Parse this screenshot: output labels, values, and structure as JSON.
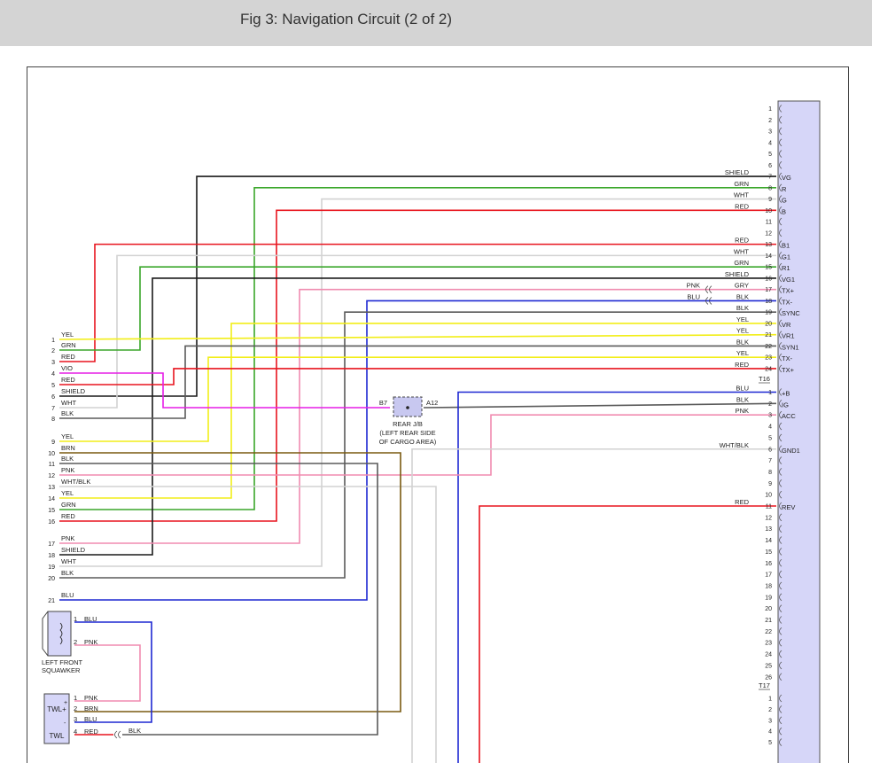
{
  "header": {
    "title": "Fig 3: Navigation Circuit (2 of 2)"
  },
  "colors": {
    "RED": "#e8141e",
    "GRN": "#3aa62a",
    "YEL": "#f2ee18",
    "BLK": "#1a1a1a",
    "WHT": "#d2d2d2",
    "SHIELD": "#1a1a1a",
    "PNK": "#f08cb0",
    "BLU": "#1e28d2",
    "VIO": "#e61ee6",
    "BRN": "#7a5a10",
    "GRY": "#5a5a5a",
    "WHT/BLK": "#d2d2d2"
  },
  "connector_t16_label": "T16",
  "connector_t17_label": "T17",
  "right_connector_pins": [
    {
      "pin": "1",
      "wire": "",
      "func": ""
    },
    {
      "pin": "2",
      "wire": "",
      "func": ""
    },
    {
      "pin": "3",
      "wire": "",
      "func": ""
    },
    {
      "pin": "4",
      "wire": "",
      "func": ""
    },
    {
      "pin": "5",
      "wire": "",
      "func": ""
    },
    {
      "pin": "6",
      "wire": "",
      "func": ""
    },
    {
      "pin": "7",
      "wire": "SHIELD",
      "func": "VG"
    },
    {
      "pin": "8",
      "wire": "GRN",
      "func": "R"
    },
    {
      "pin": "9",
      "wire": "WHT",
      "func": "G"
    },
    {
      "pin": "10",
      "wire": "RED",
      "func": "B"
    },
    {
      "pin": "11",
      "wire": "",
      "func": ""
    },
    {
      "pin": "12",
      "wire": "",
      "func": ""
    },
    {
      "pin": "13",
      "wire": "RED",
      "func": "B1"
    },
    {
      "pin": "14",
      "wire": "WHT",
      "func": "G1"
    },
    {
      "pin": "15",
      "wire": "GRN",
      "func": "R1"
    },
    {
      "pin": "16",
      "wire": "SHIELD",
      "func": "VG1"
    },
    {
      "pin": "17",
      "wire": "GRY",
      "func": "TX+",
      "inline_color": "PNK"
    },
    {
      "pin": "18",
      "wire": "BLK",
      "func": "TX-",
      "inline_color": "BLU"
    },
    {
      "pin": "19",
      "wire": "BLK",
      "func": "SYNC"
    },
    {
      "pin": "20",
      "wire": "YEL",
      "func": "VR"
    },
    {
      "pin": "21",
      "wire": "YEL",
      "func": "VR1"
    },
    {
      "pin": "22",
      "wire": "BLK",
      "func": "SYN1"
    },
    {
      "pin": "23",
      "wire": "YEL",
      "func": "TX-"
    },
    {
      "pin": "24",
      "wire": "RED",
      "func": "TX+"
    }
  ],
  "right_connector2_pins": [
    {
      "pin": "1",
      "wire": "BLU",
      "func": "+B"
    },
    {
      "pin": "2",
      "wire": "BLK",
      "func": "IG"
    },
    {
      "pin": "3",
      "wire": "PNK",
      "func": "ACC"
    },
    {
      "pin": "4",
      "wire": "",
      "func": ""
    },
    {
      "pin": "5",
      "wire": "",
      "func": ""
    },
    {
      "pin": "6",
      "wire": "WHT/BLK",
      "func": "GND1"
    },
    {
      "pin": "7",
      "wire": "",
      "func": ""
    },
    {
      "pin": "8",
      "wire": "",
      "func": ""
    },
    {
      "pin": "9",
      "wire": "",
      "func": ""
    },
    {
      "pin": "10",
      "wire": "",
      "func": ""
    },
    {
      "pin": "11",
      "wire": "RED",
      "func": "REV"
    },
    {
      "pin": "12",
      "wire": "",
      "func": ""
    },
    {
      "pin": "13",
      "wire": "",
      "func": ""
    },
    {
      "pin": "14",
      "wire": "",
      "func": ""
    },
    {
      "pin": "15",
      "wire": "",
      "func": ""
    },
    {
      "pin": "16",
      "wire": "",
      "func": ""
    },
    {
      "pin": "17",
      "wire": "",
      "func": ""
    },
    {
      "pin": "18",
      "wire": "",
      "func": ""
    },
    {
      "pin": "19",
      "wire": "",
      "func": ""
    },
    {
      "pin": "20",
      "wire": "",
      "func": ""
    },
    {
      "pin": "21",
      "wire": "",
      "func": ""
    },
    {
      "pin": "22",
      "wire": "",
      "func": ""
    },
    {
      "pin": "23",
      "wire": "",
      "func": ""
    },
    {
      "pin": "24",
      "wire": "",
      "func": ""
    },
    {
      "pin": "25",
      "wire": "",
      "func": ""
    },
    {
      "pin": "26",
      "wire": "",
      "func": ""
    }
  ],
  "right_connector3_pins": [
    "1",
    "2",
    "3",
    "4",
    "5"
  ],
  "left_connector_pins": [
    {
      "pin": "1",
      "wire": "YEL"
    },
    {
      "pin": "2",
      "wire": "GRN"
    },
    {
      "pin": "3",
      "wire": "RED"
    },
    {
      "pin": "4",
      "wire": "VIO"
    },
    {
      "pin": "5",
      "wire": "RED"
    },
    {
      "pin": "6",
      "wire": "SHIELD"
    },
    {
      "pin": "7",
      "wire": "WHT"
    },
    {
      "pin": "8",
      "wire": "BLK"
    },
    {
      "pin": "9",
      "wire": "YEL"
    },
    {
      "pin": "10",
      "wire": "BRN"
    },
    {
      "pin": "11",
      "wire": "BLK"
    },
    {
      "pin": "12",
      "wire": "PNK"
    },
    {
      "pin": "13",
      "wire": "WHT/BLK"
    },
    {
      "pin": "14",
      "wire": "YEL"
    },
    {
      "pin": "15",
      "wire": "GRN"
    },
    {
      "pin": "16",
      "wire": "RED"
    },
    {
      "pin": "17",
      "wire": "PNK"
    },
    {
      "pin": "18",
      "wire": "SHIELD"
    },
    {
      "pin": "19",
      "wire": "WHT"
    },
    {
      "pin": "20",
      "wire": "BLK"
    },
    {
      "pin": "21",
      "wire": "BLU"
    }
  ],
  "rear_jb": {
    "left_pin": "B7",
    "right_pin": "A12",
    "label_line1": "REAR J/B",
    "label_line2": "(LEFT REAR SIDE",
    "label_line3": "OF CARGO AREA)"
  },
  "squawker": {
    "label_line1": "LEFT FRONT",
    "label_line2": "SQUAWKER",
    "pins": [
      {
        "pin": "1",
        "wire": "BLU"
      },
      {
        "pin": "2",
        "wire": "PNK"
      }
    ]
  },
  "twl": {
    "label_top": "TWL+",
    "label_bottom": "TWL",
    "plus": "+",
    "minus": "-",
    "pins": [
      {
        "pin": "1",
        "wire": "PNK"
      },
      {
        "pin": "2",
        "wire": "BRN"
      },
      {
        "pin": "3",
        "wire": "BLU"
      },
      {
        "pin": "4",
        "wire": "RED"
      }
    ],
    "inline_wire": "BLK"
  }
}
